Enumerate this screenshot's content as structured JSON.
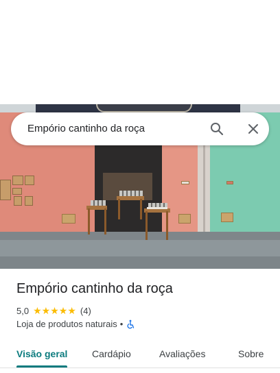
{
  "search": {
    "query": "Empório cantinho da roça"
  },
  "place": {
    "name": "Empório cantinho da roça",
    "rating": "5,0",
    "stars": [
      "★",
      "★",
      "★",
      "★",
      "★"
    ],
    "review_count": "(4)",
    "category": "Loja de produtos naturais",
    "separator": "•"
  },
  "tabs": [
    {
      "label": "Visão geral",
      "active": true
    },
    {
      "label": "Cardápio"
    },
    {
      "label": "Avaliações"
    },
    {
      "label": "Sobre"
    }
  ],
  "icons": {
    "search": "search-icon",
    "close": "close-icon",
    "accessibility": "wheelchair-icon",
    "star": "star-icon"
  },
  "colors": {
    "accent": "#0b7b7e",
    "star": "#fbbc04",
    "accessibility": "#1a73e8"
  }
}
